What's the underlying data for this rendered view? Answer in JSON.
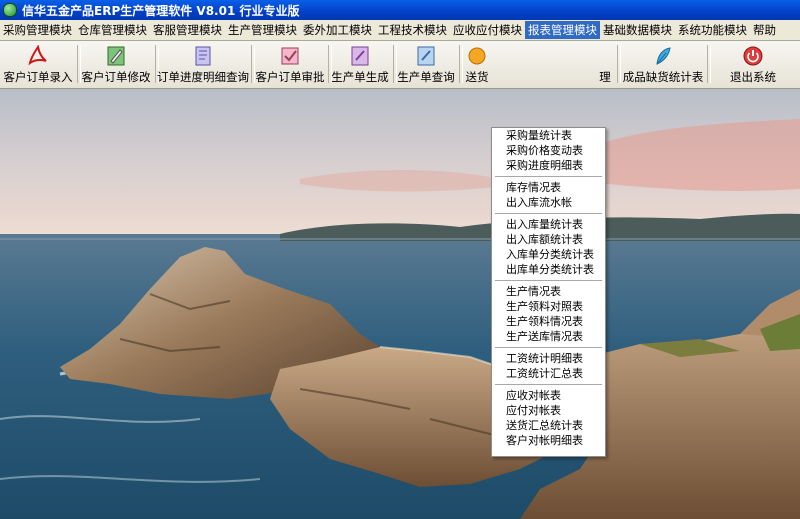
{
  "window": {
    "title": "信华五金产品ERP生产管理软件  V8.01 行业专业版"
  },
  "menu": [
    "采购管理模块",
    "仓库管理模块",
    "客服管理模块",
    "生产管理模块",
    "委外加工模块",
    "工程技术模块",
    "应收应付模块",
    "报表管理模块",
    "基础数据模块",
    "系统功能模块",
    "帮助"
  ],
  "toolbar": [
    {
      "label": "客户订单录入",
      "icon": "pdf-icon"
    },
    {
      "label": "客户订单修改",
      "icon": "edit-icon"
    },
    {
      "label": "订单进度明细查询",
      "icon": "document-icon"
    },
    {
      "label": "客户订单审批",
      "icon": "approve-icon"
    },
    {
      "label": "生产单生成",
      "icon": "generate-icon"
    },
    {
      "label": "生产单查询",
      "icon": "query-icon"
    },
    {
      "label": "送货",
      "icon": "delivery-icon"
    },
    {
      "label": "理",
      "icon": ""
    },
    {
      "label": "成品缺货统计表",
      "icon": "feather-icon"
    },
    {
      "label": "退出系统",
      "icon": "exit-icon"
    }
  ],
  "dropdown": {
    "groups": [
      [
        "采购量统计表",
        "采购价格变动表",
        "采购进度明细表"
      ],
      [
        "库存情况表",
        "出入库流水帐"
      ],
      [
        "出入库量统计表",
        "出入库额统计表",
        "入库单分类统计表",
        "出库单分类统计表"
      ],
      [
        "生产情况表",
        "生产领料对照表",
        "生产领料情况表",
        "生产送库情况表"
      ],
      [
        "工资统计明细表",
        "工资统计汇总表"
      ],
      [
        "应收对帐表",
        "应付对帐表",
        "送货汇总统计表",
        "客户对帐明细表"
      ]
    ]
  },
  "colors": {
    "title_bar": "#0340c8",
    "menu_highlight": "#316ac5",
    "menu_bg": "#ece9d8"
  }
}
